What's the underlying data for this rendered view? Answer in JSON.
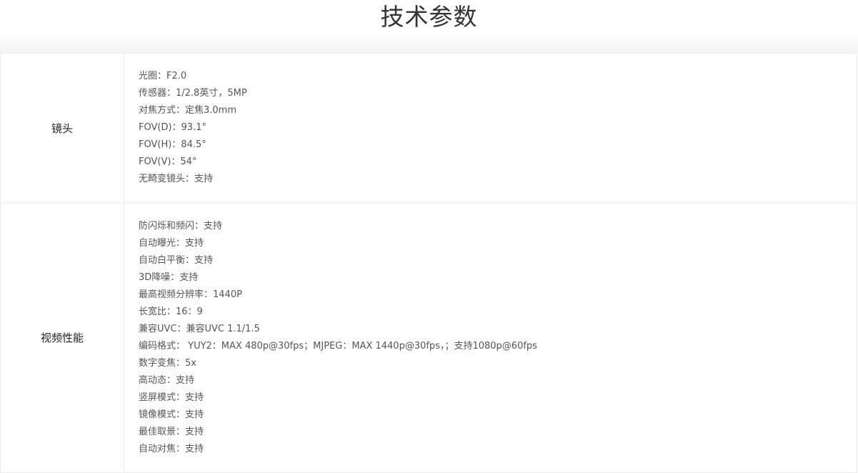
{
  "page": {
    "title": "技术参数"
  },
  "sections": {
    "lens": {
      "label": "镜头",
      "items": [
        "光圈：F2.0",
        "传感器：1/2.8英寸，5MP",
        "对焦方式：定焦3.0mm",
        "FOV(D)：93.1°",
        "FOV(H)：84.5°",
        "FOV(V)：54°",
        "无畸变镜头：支持"
      ]
    },
    "video": {
      "label": "视频性能",
      "items": [
        "防闪烁和频闪：支持",
        "自动曝光：支持",
        "自动白平衡：支持",
        "3D降噪：支持",
        "最高视频分辨率：1440P",
        "长宽比：16：9",
        "兼容UVC：兼容UVC 1.1/1.5",
        "编码格式： YUY2：MAX 480p@30fps；MJPEG：MAX 1440p@30fps，；支持1080p@60fps",
        "数字变焦：5x",
        "高动态：支持",
        "竖屏模式：支持",
        "镜像模式：支持",
        "最佳取景：支持",
        "自动对焦：支持"
      ]
    }
  }
}
